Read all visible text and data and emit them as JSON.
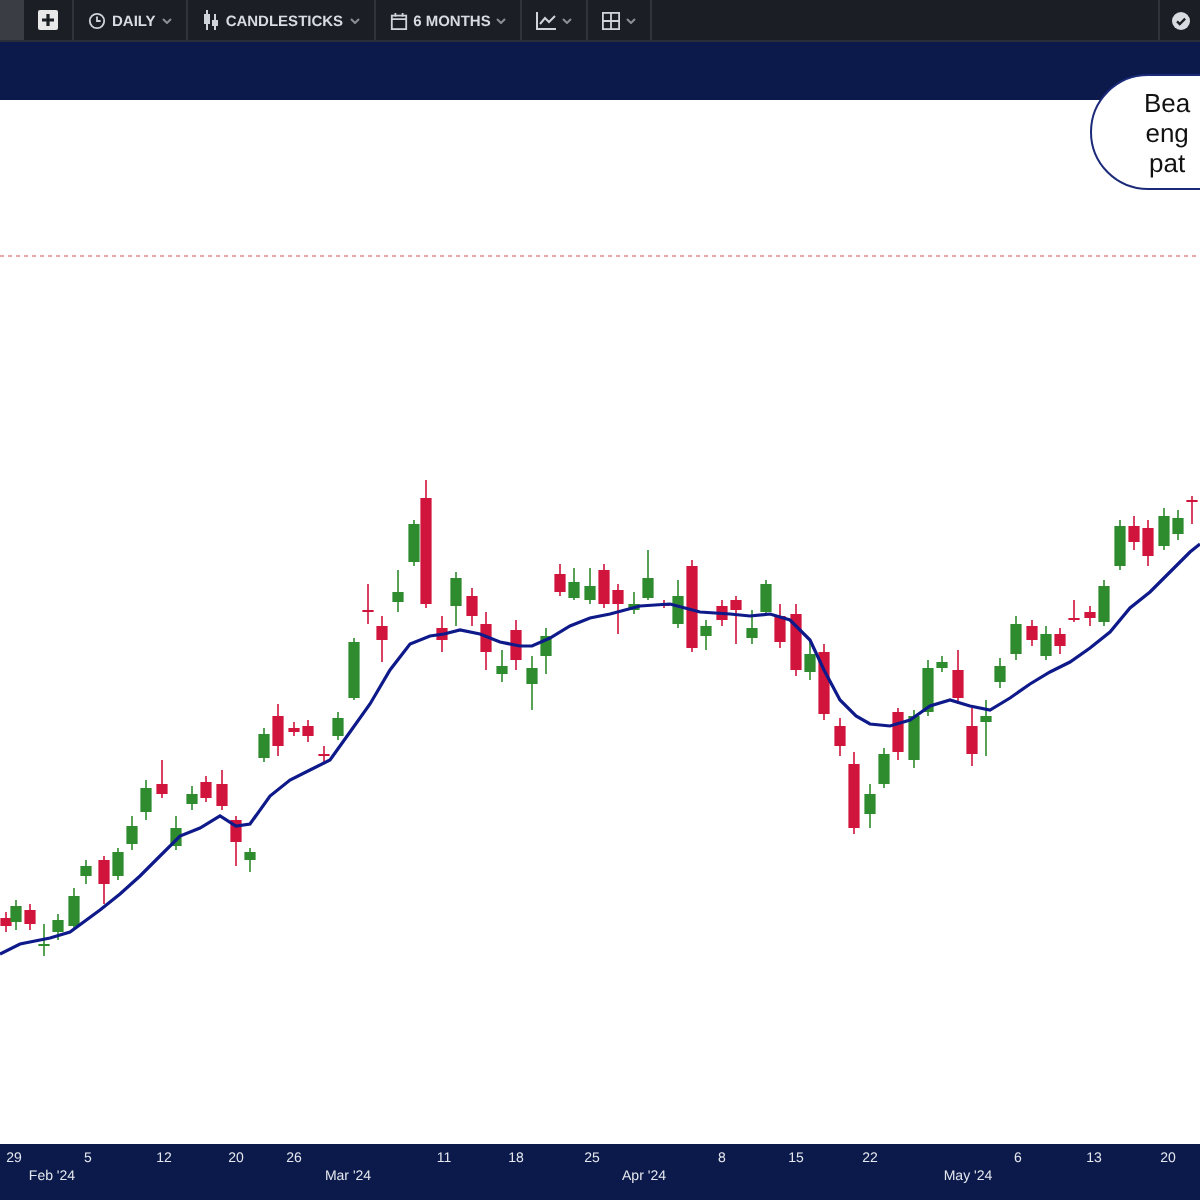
{
  "toolbar": {
    "items": [
      {
        "kind": "add"
      },
      {
        "kind": "interval",
        "label": "DAILY"
      },
      {
        "kind": "chart_type",
        "label": "CANDLESTICKS"
      },
      {
        "kind": "range",
        "label": "6 MONTHS"
      },
      {
        "kind": "indicators"
      },
      {
        "kind": "layout"
      }
    ]
  },
  "callout": {
    "lines": [
      "Bea",
      "eng",
      "pat"
    ]
  },
  "x_axis": {
    "days": [
      "29",
      "5",
      "12",
      "20",
      "26",
      "11",
      "18",
      "25",
      "8",
      "15",
      "22",
      "6",
      "13",
      "20"
    ],
    "months": [
      "Feb '24",
      "Mar '24",
      "Apr '24",
      "May '24"
    ]
  }
}
